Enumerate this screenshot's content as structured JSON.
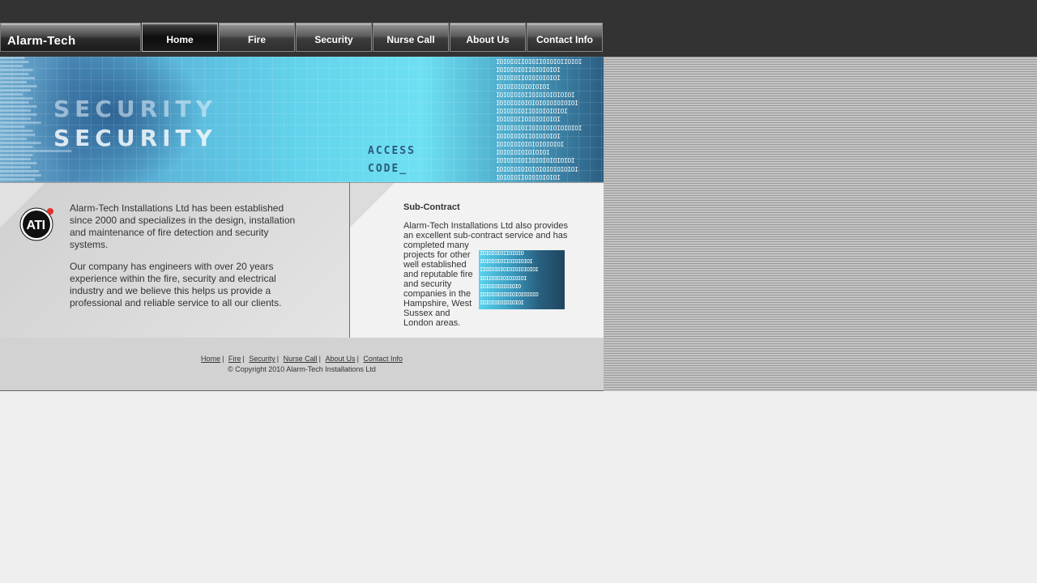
{
  "nav": {
    "logo": "Alarm-Tech",
    "items": [
      {
        "label": "Home",
        "active": true
      },
      {
        "label": "Fire",
        "active": false
      },
      {
        "label": "Security",
        "active": false
      },
      {
        "label": "Nurse Call",
        "active": false
      },
      {
        "label": "About Us",
        "active": false
      },
      {
        "label": "Contact Info",
        "active": false
      }
    ]
  },
  "banner": {
    "security_line1": "SECURITY",
    "security_line2": "SECURITY",
    "access_line1": "ACCESS",
    "access_line2": "CODE_"
  },
  "intro": {
    "logo_text": "ATI",
    "paragraph1": "Alarm-Tech Installations Ltd has been established since 2000 and specializes in the design, installation and maintenance of fire detection and security systems.",
    "paragraph2": "Our company has engineers with over 20 years experience within the fire, security and electrical industry and we believe this helps us provide a professional and reliable service to all our clients."
  },
  "subcontract": {
    "title": "Sub-Contract",
    "lead": "Alarm-Tech Installations Ltd also provides an excellent sub-contract service and has",
    "wrapped": "completed many projects for other well established and reputable fire and security companies in the Hampshire, West Sussex and London areas."
  },
  "footer": {
    "links": [
      "Home",
      "Fire",
      "Security",
      "Nurse Call",
      "About Us",
      "Contact Info"
    ],
    "copyright": "© Copyright 2010 Alarm-Tech Installations Ltd"
  },
  "colors": {
    "topbar": "#333333",
    "page_background": "#efefef",
    "banner_accent": "#63d4ec"
  }
}
